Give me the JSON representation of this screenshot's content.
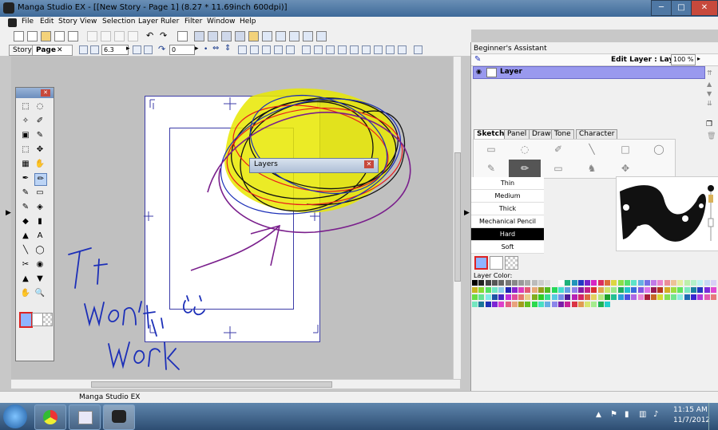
{
  "window": {
    "app_title": "Manga Studio EX - [[New Story - Page 1] (8.27 * 11.69inch 600dpi)]",
    "min_glyph": "─",
    "max_glyph": "□",
    "close_glyph": "✕"
  },
  "menu": [
    "File",
    "Edit",
    "Story",
    "View",
    "Selection",
    "Layer",
    "Ruler",
    "Filter",
    "Window",
    "Help"
  ],
  "doc_tabs": {
    "story": "Story",
    "page": "Page",
    "zoom_value": "6.3",
    "rotate_value": "0"
  },
  "canvas": {
    "layers_window_title": "Layers",
    "handwritten_text": "It won't work"
  },
  "right_panel": {
    "assistant_title": "Beginner's Assistant",
    "edit_layer_label": "Edit Layer : Layer",
    "zoom_percent": "100 %",
    "layer_name": "Layer",
    "tabs": [
      "Sketch",
      "Panel",
      "Draw",
      "Tone",
      "Character"
    ],
    "pencil_sizes": [
      "Thin",
      "Medium",
      "Thick",
      "Mechanical Pencil",
      "Hard",
      "Soft"
    ],
    "selected_size": "Hard",
    "layer_color_label": "Layer Color:"
  },
  "status_bar": {
    "text": "Manga Studio EX"
  },
  "taskbar": {
    "time": "11:15 AM",
    "date": "11/7/2012"
  },
  "colors": {
    "titlebar": "#4a76a3",
    "selected_layer": "#9999ee",
    "highlight": "#e8e800",
    "ink_blue": "#1c2fb8",
    "ink_purple": "#7a1f8c",
    "ink_red": "#e81c1c"
  },
  "icons": [
    "windows-start-icon",
    "chrome-icon",
    "paint-icon",
    "manga-studio-icon",
    "flag-icon",
    "volume-icon",
    "network-icon"
  ]
}
